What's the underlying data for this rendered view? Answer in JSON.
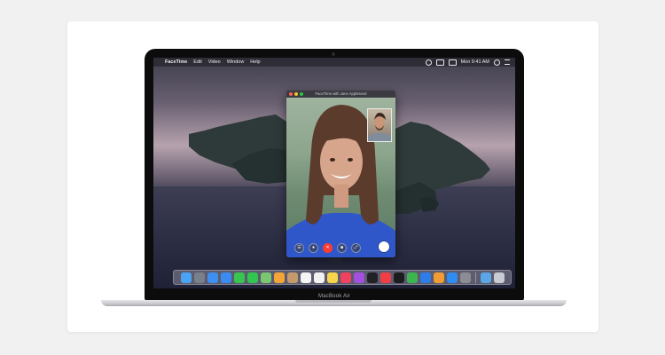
{
  "laptop": {
    "brand_label": "MacBook Air"
  },
  "menubar": {
    "apple_glyph": "",
    "app_name": "FaceTime",
    "items": [
      "Edit",
      "Video",
      "Window",
      "Help"
    ],
    "clock": "Mon 9:41 AM"
  },
  "facetime": {
    "window_title": "FaceTime with Jane Appleseed",
    "controls": [
      {
        "name": "sidebar-icon",
        "glyph": "☰"
      },
      {
        "name": "mute-icon",
        "glyph": "●"
      },
      {
        "name": "end-call-icon",
        "glyph": "✕"
      },
      {
        "name": "camera-icon",
        "glyph": "■"
      },
      {
        "name": "fullscreen-icon",
        "glyph": "⤢"
      }
    ]
  },
  "dock": {
    "icons": [
      {
        "name": "finder-icon",
        "color": "#4aa3f5"
      },
      {
        "name": "launchpad-icon",
        "color": "#7a7f8c"
      },
      {
        "name": "safari-icon",
        "color": "#3d8ff0"
      },
      {
        "name": "mail-icon",
        "color": "#3b8cf2"
      },
      {
        "name": "messages-icon",
        "color": "#36c64f"
      },
      {
        "name": "facetime-icon",
        "color": "#31c650"
      },
      {
        "name": "maps-icon",
        "color": "#7bc770"
      },
      {
        "name": "photos-icon",
        "color": "#f4a536"
      },
      {
        "name": "contacts-icon",
        "color": "#c49a6c"
      },
      {
        "name": "calendar-icon",
        "color": "#f5f5f5"
      },
      {
        "name": "reminders-icon",
        "color": "#f2f2f2"
      },
      {
        "name": "notes-icon",
        "color": "#f6d54c"
      },
      {
        "name": "music-icon",
        "color": "#f0415f"
      },
      {
        "name": "podcasts-icon",
        "color": "#a44fe0"
      },
      {
        "name": "tv-icon",
        "color": "#222226"
      },
      {
        "name": "news-icon",
        "color": "#ef3f45"
      },
      {
        "name": "stocks-icon",
        "color": "#1c1c1e"
      },
      {
        "name": "numbers-icon",
        "color": "#3cb551"
      },
      {
        "name": "keynote-icon",
        "color": "#2d7de8"
      },
      {
        "name": "pages-icon",
        "color": "#f19b35"
      },
      {
        "name": "app-store-icon",
        "color": "#2f8cf0"
      },
      {
        "name": "system-preferences-icon",
        "color": "#8c8c94"
      },
      {
        "name": "downloads-folder-icon",
        "color": "#5aa6e6"
      },
      {
        "name": "trash-icon",
        "color": "#c9cbd2"
      }
    ]
  }
}
